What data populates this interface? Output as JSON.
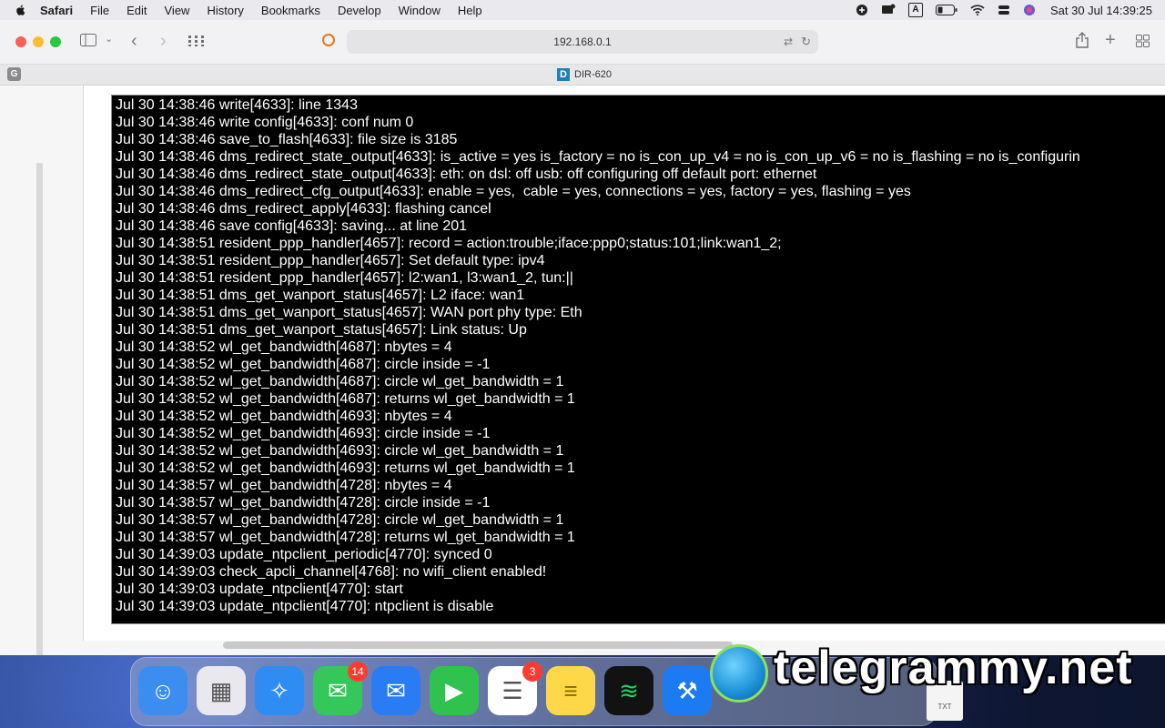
{
  "menubar": {
    "app": "Safari",
    "items": [
      "File",
      "Edit",
      "View",
      "History",
      "Bookmarks",
      "Develop",
      "Window",
      "Help"
    ],
    "clock": "Sat 30 Jul  14:39:25",
    "input_source": "A"
  },
  "toolbar": {
    "address": "192.168.0.1"
  },
  "tabbar": {
    "group_label": "G",
    "tab_favicon": "D",
    "tab_title": "DIR-620"
  },
  "console": {
    "lines": [
      "Jul 30 14:38:46 write[4633]: line 1343",
      "Jul 30 14:38:46 write config[4633]: conf num 0",
      "Jul 30 14:38:46 save_to_flash[4633]: file size is 3185",
      "Jul 30 14:38:46 dms_redirect_state_output[4633]: is_active = yes is_factory = no is_con_up_v4 = no is_con_up_v6 = no is_flashing = no is_configurin",
      "Jul 30 14:38:46 dms_redirect_state_output[4633]: eth: on dsl: off usb: off configuring off default port: ethernet",
      "Jul 30 14:38:46 dms_redirect_cfg_output[4633]: enable = yes,  cable = yes, connections = yes, factory = yes, flashing = yes",
      "Jul 30 14:38:46 dms_redirect_apply[4633]: flashing cancel",
      "Jul 30 14:38:46 save config[4633]: saving... at line 201",
      "Jul 30 14:38:51 resident_ppp_handler[4657]: record = action:trouble;iface:ppp0;status:101;link:wan1_2;",
      "Jul 30 14:38:51 resident_ppp_handler[4657]: Set default type: ipv4",
      "Jul 30 14:38:51 resident_ppp_handler[4657]: l2:wan1, l3:wan1_2, tun:||",
      "Jul 30 14:38:51 dms_get_wanport_status[4657]: L2 iface: wan1",
      "Jul 30 14:38:51 dms_get_wanport_status[4657]: WAN port phy type: Eth",
      "Jul 30 14:38:51 dms_get_wanport_status[4657]: Link status: Up",
      "Jul 30 14:38:52 wl_get_bandwidth[4687]: nbytes = 4",
      "Jul 30 14:38:52 wl_get_bandwidth[4687]: circle inside = -1",
      "Jul 30 14:38:52 wl_get_bandwidth[4687]: circle wl_get_bandwidth = 1",
      "Jul 30 14:38:52 wl_get_bandwidth[4687]: returns wl_get_bandwidth = 1",
      "Jul 30 14:38:52 wl_get_bandwidth[4693]: nbytes = 4",
      "Jul 30 14:38:52 wl_get_bandwidth[4693]: circle inside = -1",
      "Jul 30 14:38:52 wl_get_bandwidth[4693]: circle wl_get_bandwidth = 1",
      "Jul 30 14:38:52 wl_get_bandwidth[4693]: returns wl_get_bandwidth = 1",
      "Jul 30 14:38:57 wl_get_bandwidth[4728]: nbytes = 4",
      "Jul 30 14:38:57 wl_get_bandwidth[4728]: circle inside = -1",
      "Jul 30 14:38:57 wl_get_bandwidth[4728]: circle wl_get_bandwidth = 1",
      "Jul 30 14:38:57 wl_get_bandwidth[4728]: returns wl_get_bandwidth = 1",
      "Jul 30 14:39:03 update_ntpclient_periodic[4770]: synced 0",
      "Jul 30 14:39:03 check_apcli_channel[4768]: no wifi_client enabled!",
      "Jul 30 14:39:03 update_ntpclient[4770]: start",
      "Jul 30 14:39:03 update_ntpclient[4770]: ntpclient is disable"
    ]
  },
  "dock": {
    "apps": [
      {
        "name": "finder-icon",
        "color": "#3b8ef0"
      },
      {
        "name": "launchpad-icon",
        "color": "#e8e8ee"
      },
      {
        "name": "safari-icon",
        "color": "#2f8cf2"
      },
      {
        "name": "messages-icon",
        "color": "#35c759",
        "badge": "14"
      },
      {
        "name": "mail-icon",
        "color": "#2a7cf5"
      },
      {
        "name": "facetime-icon",
        "color": "#30c24f"
      },
      {
        "name": "reminders-icon",
        "color": "#ffffff",
        "badge": "3"
      },
      {
        "name": "notes-icon",
        "color": "#ffd84a"
      },
      {
        "name": "spotify-icon",
        "color": "#121212"
      },
      {
        "name": "xcode-icon",
        "color": "#1c7bf2"
      }
    ],
    "watermark": "telegrammy.net",
    "file_label": "TXT"
  }
}
